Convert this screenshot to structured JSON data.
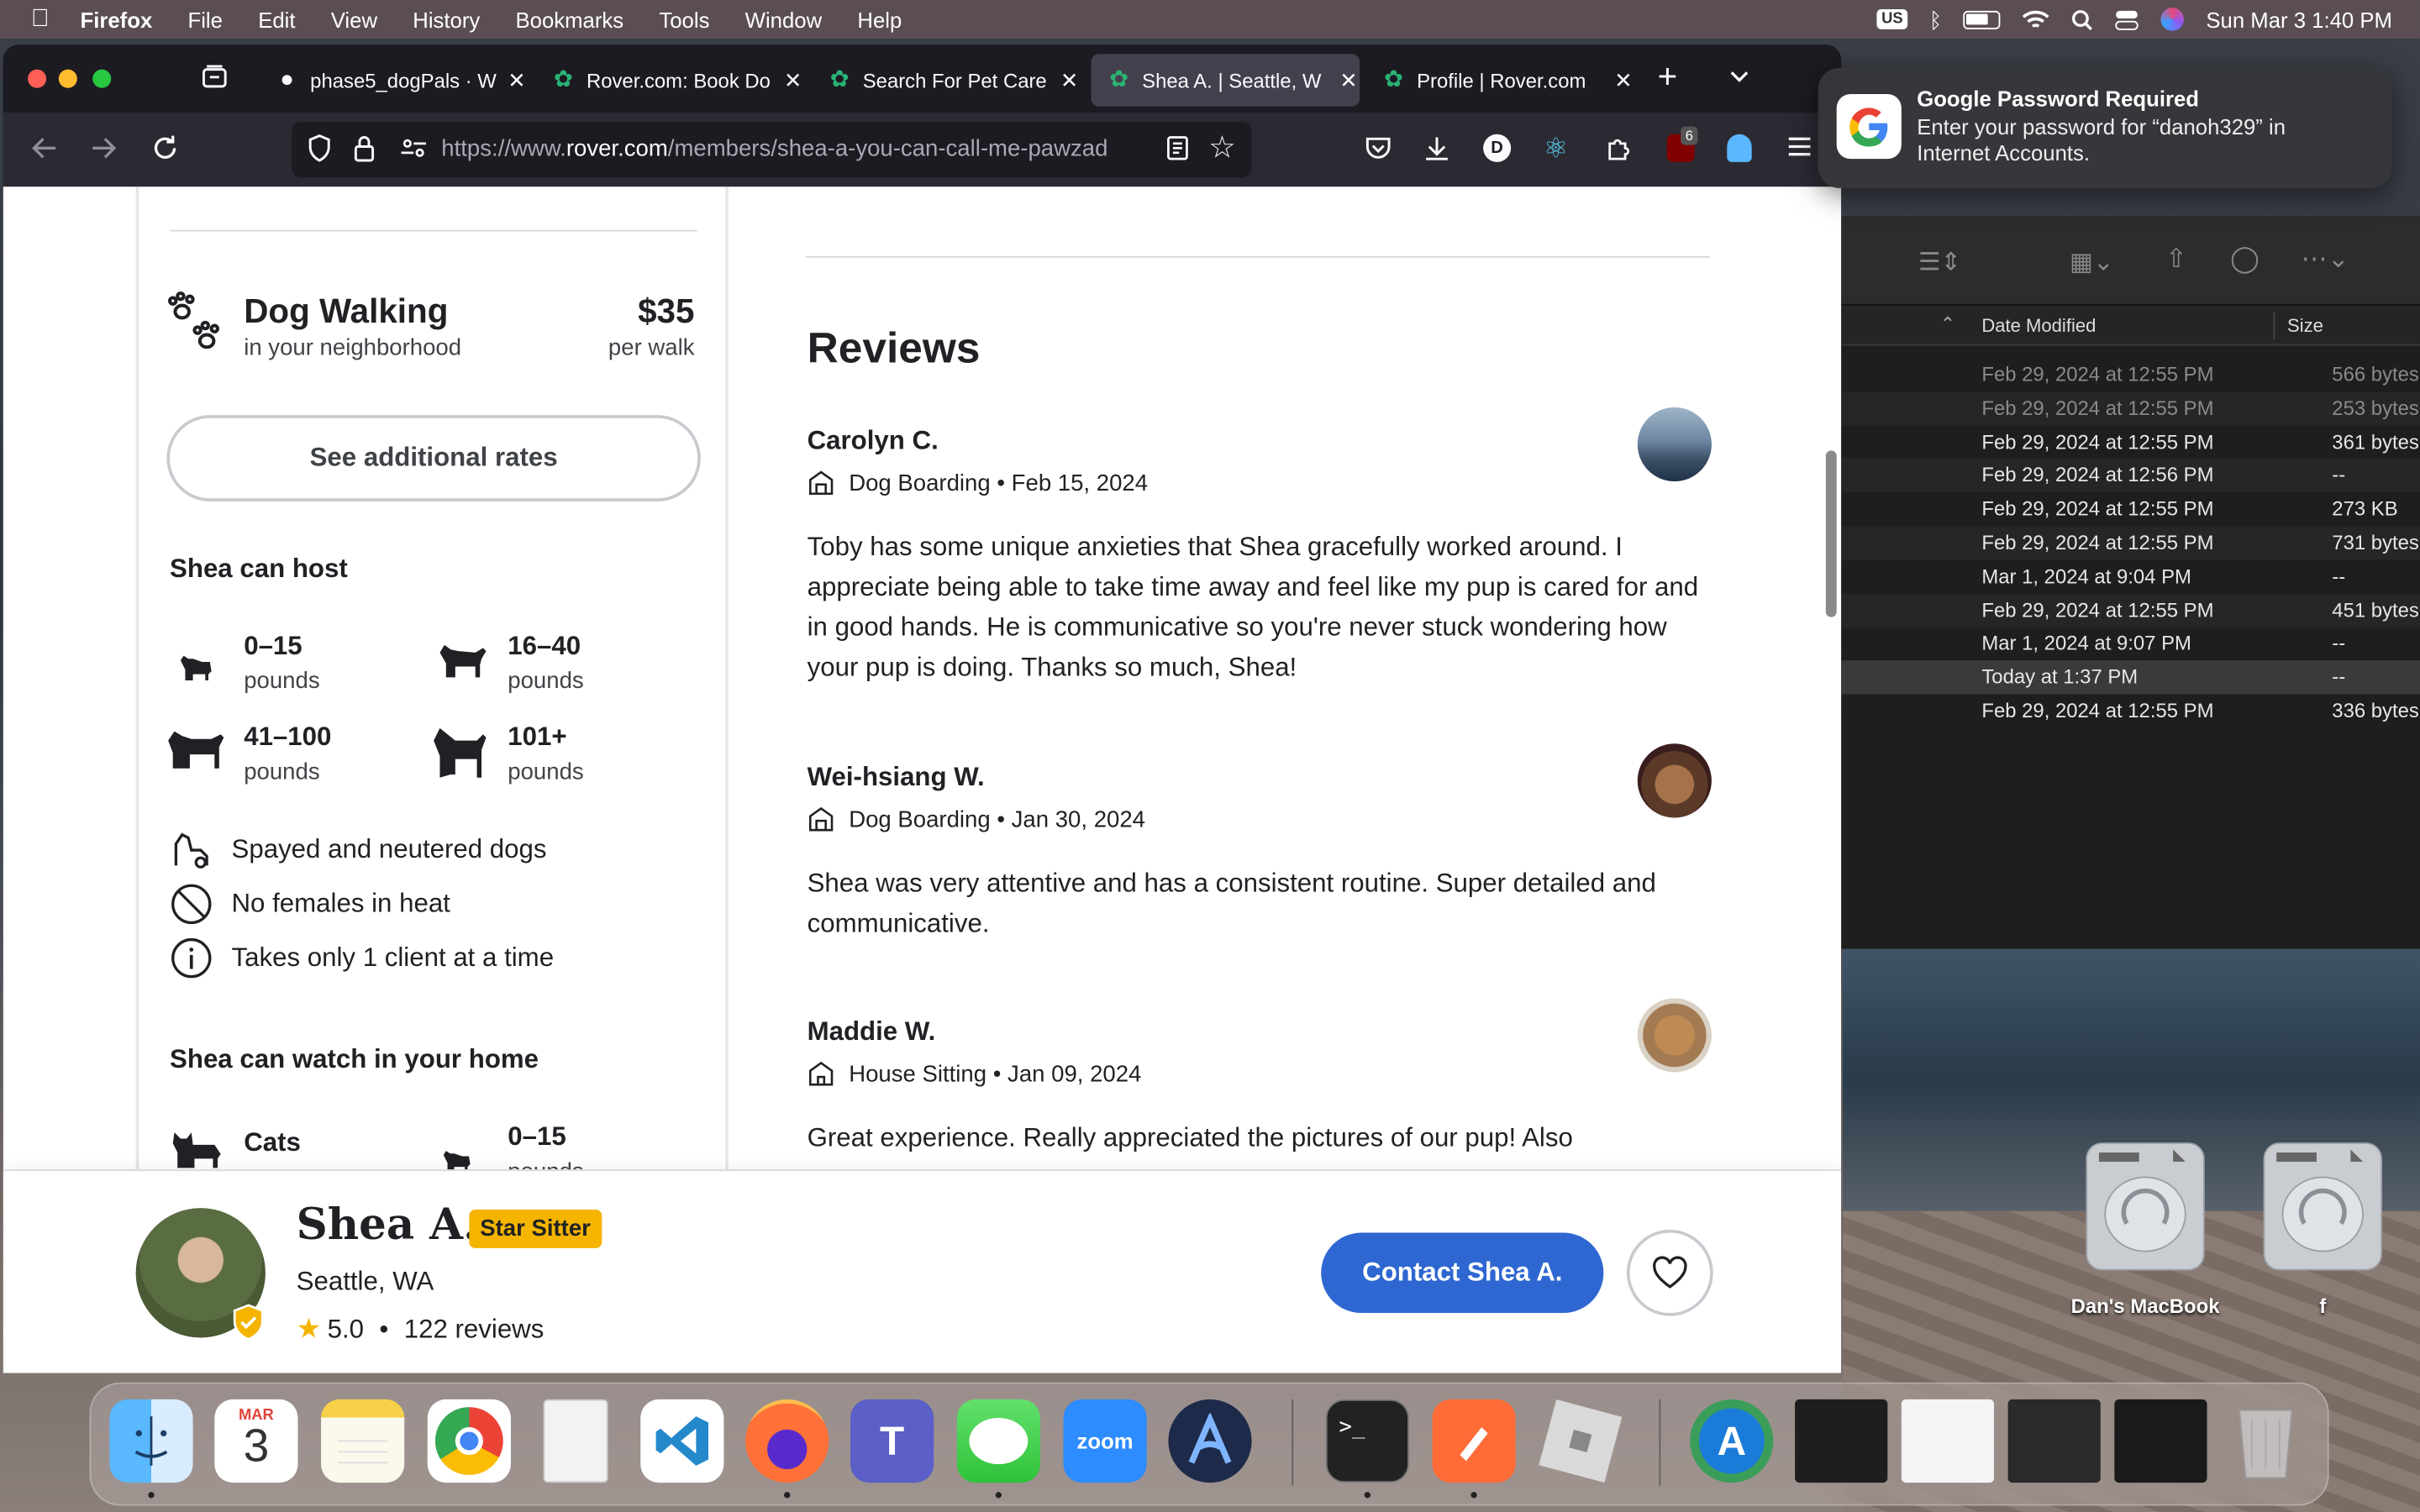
{
  "menubar": {
    "app_name": "Firefox",
    "menus": [
      "File",
      "Edit",
      "View",
      "History",
      "Bookmarks",
      "Tools",
      "Window",
      "Help"
    ],
    "input_badge": "US",
    "clock": "Sun Mar 3  1:40 PM"
  },
  "browser": {
    "tabs": [
      {
        "title": "phase5_dogPals · W",
        "active": false
      },
      {
        "title": "Rover.com: Book Do",
        "active": false
      },
      {
        "title": "Search For Pet Care",
        "active": false
      },
      {
        "title": "Shea A. | Seattle, W",
        "active": true
      },
      {
        "title": "Profile | Rover.com",
        "active": false
      }
    ],
    "url_prefix": "https://www.",
    "url_domain": "rover.com",
    "url_path": "/members/shea-a-you-can-call-me-pawzad",
    "extension_badge": "6"
  },
  "service": {
    "title": "Dog Walking",
    "subtitle": "in your neighborhood",
    "price": "$35",
    "unit": "per walk",
    "rates_button": "See additional rates"
  },
  "host": {
    "heading": "Shea can host",
    "sizes": [
      {
        "range": "0–15",
        "unit": "pounds"
      },
      {
        "range": "16–40",
        "unit": "pounds"
      },
      {
        "range": "41–100",
        "unit": "pounds"
      },
      {
        "range": "101+",
        "unit": "pounds"
      }
    ],
    "policies": [
      "Spayed and neutered dogs",
      "No females in heat",
      "Takes only 1 client at a time"
    ]
  },
  "watch": {
    "heading": "Shea can watch in your home",
    "items": [
      {
        "label": "Cats"
      },
      {
        "range": "0–15",
        "unit": "pounds"
      }
    ]
  },
  "reviews": {
    "heading": "Reviews",
    "items": [
      {
        "name": "Carolyn C.",
        "service": "Dog Boarding",
        "date": "Feb 15, 2024",
        "text": "Toby has some unique anxieties that Shea gracefully worked around. I appreciate being able to take time away and feel like my pup is cared for and in good hands. He is communicative so you're never stuck wondering how your pup is doing. Thanks so much, Shea!"
      },
      {
        "name": "Wei-hsiang W.",
        "service": "Dog Boarding",
        "date": "Jan 30, 2024",
        "text": "Shea was very attentive and has a consistent routine. Super detailed and communicative."
      },
      {
        "name": "Maddie W.",
        "service": "House Sitting",
        "date": "Jan 09, 2024",
        "text": "Great experience. Really appreciated the pictures of our pup! Also"
      }
    ]
  },
  "profile": {
    "name": "Shea A.",
    "badge": "Star Sitter",
    "location": "Seattle, WA",
    "rating": "5.0",
    "reviews": "122 reviews",
    "contact_button": "Contact Shea A."
  },
  "finder": {
    "col_date": "Date Modified",
    "col_size": "Size",
    "rows": [
      {
        "date": "Feb 29, 2024 at 12:55 PM",
        "size": "566 bytes"
      },
      {
        "date": "Feb 29, 2024 at 12:55 PM",
        "size": "253 bytes"
      },
      {
        "date": "Feb 29, 2024 at 12:55 PM",
        "size": "361 bytes"
      },
      {
        "date": "Feb 29, 2024 at 12:56 PM",
        "size": "--"
      },
      {
        "date": "Feb 29, 2024 at 12:55 PM",
        "size": "273 KB"
      },
      {
        "date": "Feb 29, 2024 at 12:55 PM",
        "size": "731 bytes"
      },
      {
        "date": "Mar 1, 2024 at 9:04 PM",
        "size": "--"
      },
      {
        "date": "Feb 29, 2024 at 12:55 PM",
        "size": "451 bytes"
      },
      {
        "date": "Mar 1, 2024 at 9:07 PM",
        "size": "--"
      },
      {
        "date": "Today at 1:37 PM",
        "size": "--"
      },
      {
        "date": "Feb 29, 2024 at 12:55 PM",
        "size": "336 bytes"
      }
    ]
  },
  "notification": {
    "title": "Google Password Required",
    "body": "Enter your password for “danoh329” in Internet Accounts."
  },
  "desktop": {
    "disk1": "Dan's MacBook",
    "disk2": "f"
  },
  "dock": {
    "calendar_month": "MAR",
    "calendar_day": "3",
    "zoom_label": "zoom"
  },
  "colors": {
    "rover_green": "#2ab373",
    "contact_blue": "#2e67d1",
    "star_gold": "#f4b400"
  }
}
